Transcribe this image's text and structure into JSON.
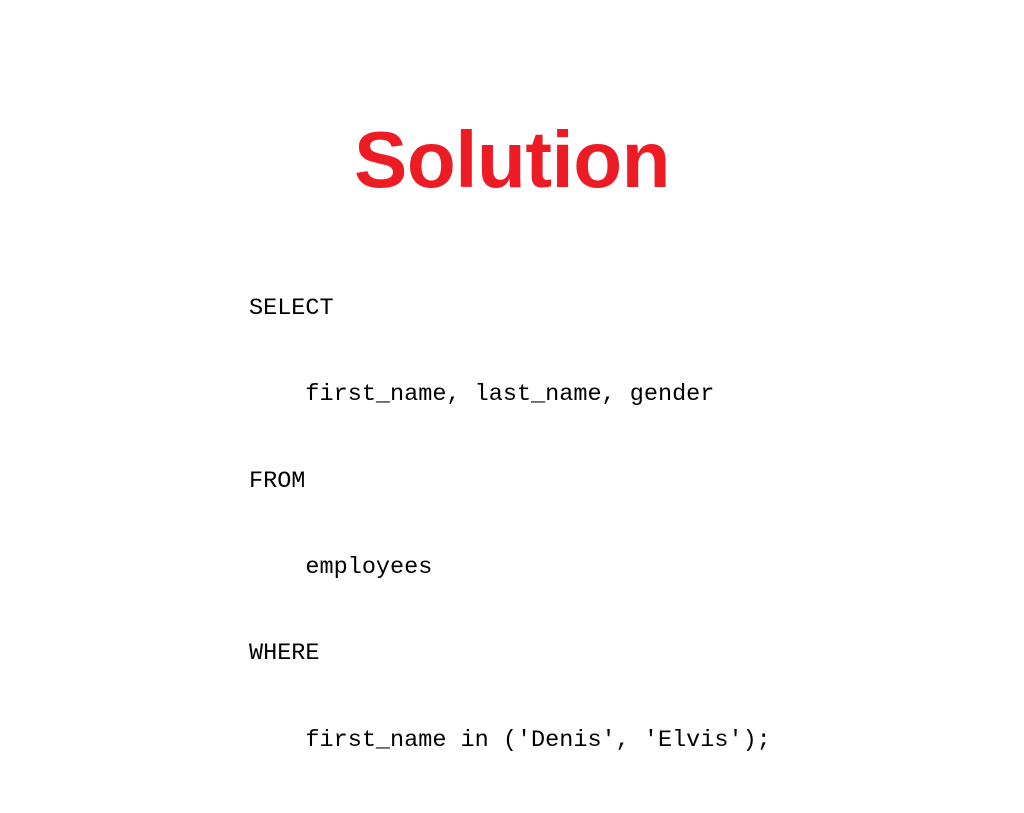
{
  "slide": {
    "background_color": "#FFFFFF",
    "title": {
      "text": "Solution",
      "color": "#ED1C24"
    },
    "code": {
      "language": "sql",
      "text_color": "#000000",
      "lines": [
        "SELECT",
        "    first_name, last_name, gender",
        "FROM",
        "    employees",
        "WHERE",
        "    first_name in ('Denis', 'Elvis');"
      ],
      "full_text": "SELECT\n    first_name, last_name, gender\nFROM\n    employees\nWHERE\n    first_name in ('Denis', 'Elvis');"
    }
  }
}
